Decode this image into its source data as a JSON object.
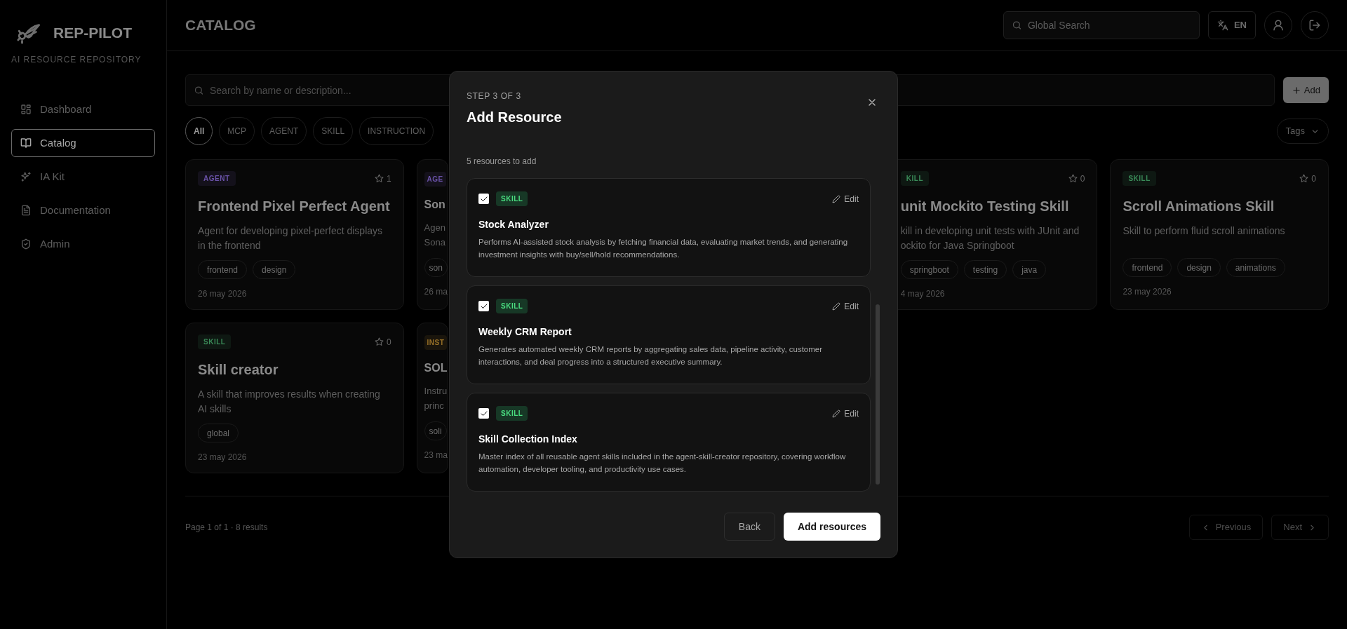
{
  "sidebar": {
    "brand": "REP-PILOT",
    "subtitle": "AI RESOURCE REPOSITORY",
    "items": [
      {
        "label": "Dashboard",
        "selected": false
      },
      {
        "label": "Catalog",
        "selected": true
      },
      {
        "label": "IA Kit",
        "selected": false
      },
      {
        "label": "Documentation",
        "selected": false
      },
      {
        "label": "Admin",
        "selected": false
      }
    ]
  },
  "header": {
    "title": "CATALOG",
    "global_search": {
      "placeholder": "Global Search"
    },
    "language": "EN"
  },
  "toolbar": {
    "search": {
      "placeholder": "Search by name or description..."
    },
    "add_button": "Add",
    "filters": [
      {
        "label": "All",
        "selected": true
      },
      {
        "label": "MCP",
        "selected": false
      },
      {
        "label": "AGENT",
        "selected": false
      },
      {
        "label": "SKILL",
        "selected": false
      },
      {
        "label": "INSTRUCTION",
        "selected": false
      }
    ],
    "tags_dropdown": "Tags"
  },
  "card_rows": [
    [
      {
        "kind": "full",
        "color": "#6a52a8",
        "badge": "AGENT",
        "favorites": "1",
        "title": "Frontend Pixel Perfect Agent",
        "description": "Agent for developing pixel-perfect displays in the frontend",
        "tags": [
          "frontend",
          "design"
        ],
        "date": "26 may 2026"
      },
      {
        "kind": "cut-right",
        "color": "#6a52a8",
        "badge": "AGE",
        "title": "Son",
        "description_lines": [
          "Agen",
          "Sona"
        ],
        "tags": [
          "son"
        ],
        "date": "26 ma"
      },
      {
        "kind": "cut-left",
        "color": "#3a8a58",
        "badge": "KILL",
        "favorites": "0",
        "title": "unit Mockito Testing Skill",
        "description_lines": [
          "kill in developing unit tests with JUnit and",
          "ockito for Java Springboot"
        ],
        "tags": [
          "springboot",
          "testing",
          "java"
        ],
        "date": "4 may 2026"
      },
      {
        "kind": "full",
        "color": "#3a8a58",
        "badge": "SKILL",
        "favorites": "0",
        "title": "Scroll Animations Skill",
        "description": "Skill to perform fluid scroll animations",
        "tags": [
          "frontend",
          "design",
          "animations"
        ],
        "date": "23 may 2026"
      }
    ],
    [
      {
        "kind": "full",
        "color": "#3a8a58",
        "badge": "SKILL",
        "favorites": "0",
        "title": "Skill creator",
        "description": "A skill that improves results when creating AI skills",
        "tags": [
          "global"
        ],
        "date": "23 may 2026"
      },
      {
        "kind": "cut-right",
        "color": "#9a7228",
        "badge": "INST",
        "title": "SOL",
        "description_lines": [
          "Instru",
          "princ"
        ],
        "tags": [
          "soli"
        ],
        "date": "23 ma"
      }
    ]
  ],
  "pagination": {
    "summary": "Page 1 of 1 · 8 results",
    "previous": {
      "label": "Previous",
      "disabled": true
    },
    "next": {
      "label": "Next",
      "disabled": true
    }
  },
  "modal": {
    "step": "STEP 3 OF 3",
    "title": "Add Resource",
    "count": "5 resources to add",
    "items": [
      {
        "checked": true,
        "badge": "SKILL",
        "edit": "Edit",
        "title": "Stock Analyzer",
        "description": "Performs AI-assisted stock analysis by fetching financial data, evaluating market trends, and generating investment insights with buy/sell/hold recommendations."
      },
      {
        "checked": true,
        "badge": "SKILL",
        "edit": "Edit",
        "title": "Weekly CRM Report",
        "description": "Generates automated weekly CRM reports by aggregating sales data, pipeline activity, customer interactions, and deal progress into a structured executive summary."
      },
      {
        "checked": true,
        "badge": "SKILL",
        "edit": "Edit",
        "title": "Skill Collection Index",
        "description": "Master index of all reusable agent skills included in the agent-skill-creator repository, covering workflow automation, developer tooling, and productivity use cases."
      }
    ],
    "back_button": "Back",
    "submit_button": "Add resources"
  }
}
